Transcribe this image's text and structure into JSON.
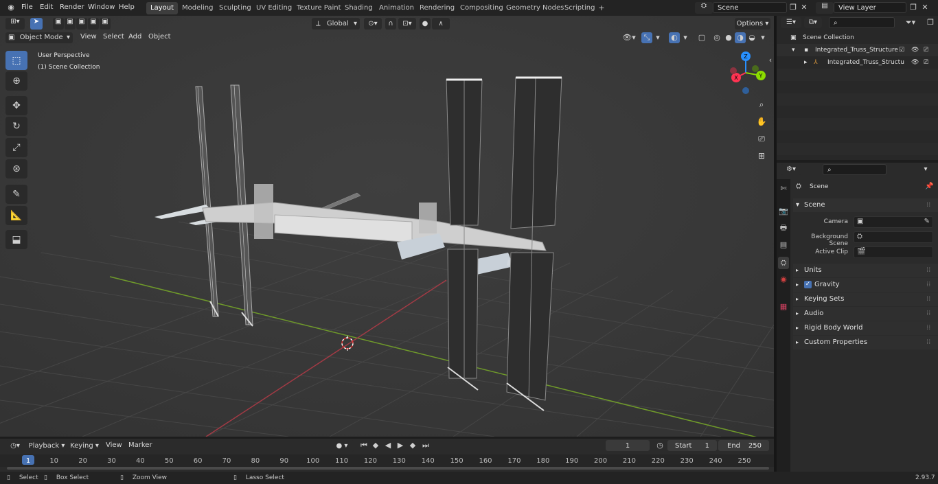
{
  "menu": [
    "File",
    "Edit",
    "Render",
    "Window",
    "Help"
  ],
  "workspaces": [
    "Layout",
    "Modeling",
    "Sculpting",
    "UV Editing",
    "Texture Paint",
    "Shading",
    "Animation",
    "Rendering",
    "Compositing",
    "Geometry Nodes",
    "Scripting"
  ],
  "active_workspace": "Layout",
  "scene_name": "Scene",
  "view_layer": "View Layer",
  "header": {
    "mode": "Object Mode",
    "view": "View",
    "select": "Select",
    "add": "Add",
    "object": "Object",
    "transform_orientation": "Global",
    "options": "Options"
  },
  "viewport": {
    "perspective_label": "User Perspective",
    "collection_label": "(1) Scene Collection"
  },
  "gizmo": {
    "z": "Z",
    "y": "Y",
    "x": "X"
  },
  "outliner": {
    "root": "Scene Collection",
    "collection": "Integrated_Truss_Structure",
    "object": "Integrated_Truss_Structu"
  },
  "properties": {
    "title": "Scene",
    "panel": "Scene",
    "camera_label": "Camera",
    "bg_scene_label": "Background Scene",
    "active_clip_label": "Active Clip",
    "sections": [
      "Units",
      "Gravity",
      "Keying Sets",
      "Audio",
      "Rigid Body World",
      "Custom Properties"
    ]
  },
  "timeline": {
    "playback": "Playback",
    "keying": "Keying",
    "view": "View",
    "marker": "Marker",
    "current_frame": "1",
    "start_label": "Start",
    "start": "1",
    "end_label": "End",
    "end": "250",
    "ruler": [
      "1",
      "10",
      "20",
      "30",
      "40",
      "50",
      "60",
      "70",
      "80",
      "90",
      "100",
      "110",
      "120",
      "130",
      "140",
      "150",
      "160",
      "170",
      "180",
      "190",
      "200",
      "210",
      "220",
      "230",
      "240",
      "250"
    ]
  },
  "status": {
    "select": "Select",
    "box_select": "Box Select",
    "zoom_view": "Zoom View",
    "lasso_select": "Lasso Select",
    "version": "2.93.7"
  },
  "colors": {
    "accent": "#4772b3",
    "axis_x": "#ff3352",
    "axis_y": "#8bdc00",
    "axis_z": "#2890ff"
  }
}
